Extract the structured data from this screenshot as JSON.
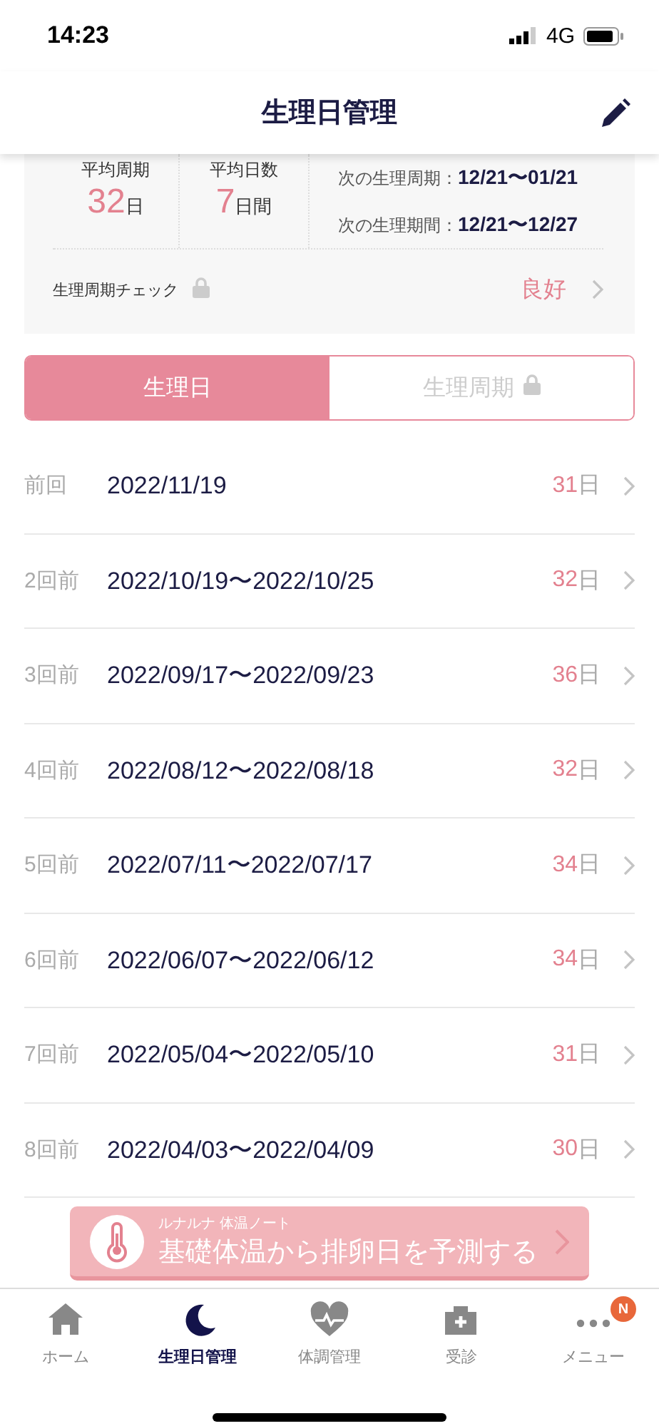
{
  "status_bar": {
    "time": "14:23",
    "network": "4G"
  },
  "header": {
    "title": "生理日管理"
  },
  "summary": {
    "stats": [
      {
        "label": "平均周期",
        "value": "32",
        "unit": "日"
      },
      {
        "label": "平均日数",
        "value": "7",
        "unit": "日間"
      }
    ],
    "forecasts": [
      {
        "label": "次の生理周期：",
        "value": "12/21〜01/21"
      },
      {
        "label": "次の生理期間：",
        "value": "12/21〜12/27"
      }
    ],
    "check": {
      "label": "生理周期チェック",
      "locked": true,
      "result": "良好"
    }
  },
  "segments": [
    {
      "label": "生理日",
      "selected": true,
      "locked": false
    },
    {
      "label": "生理周期",
      "selected": false,
      "locked": true
    }
  ],
  "history": [
    {
      "ago": "前回",
      "dates": "2022/11/19",
      "days": "31",
      "unit": "日"
    },
    {
      "ago": "2回前",
      "dates": "2022/10/19〜2022/10/25",
      "days": "32",
      "unit": "日"
    },
    {
      "ago": "3回前",
      "dates": "2022/09/17〜2022/09/23",
      "days": "36",
      "unit": "日"
    },
    {
      "ago": "4回前",
      "dates": "2022/08/12〜2022/08/18",
      "days": "32",
      "unit": "日"
    },
    {
      "ago": "5回前",
      "dates": "2022/07/11〜2022/07/17",
      "days": "34",
      "unit": "日"
    },
    {
      "ago": "6回前",
      "dates": "2022/06/07〜2022/06/12",
      "days": "34",
      "unit": "日"
    },
    {
      "ago": "7回前",
      "dates": "2022/05/04〜2022/05/10",
      "days": "31",
      "unit": "日"
    },
    {
      "ago": "8回前",
      "dates": "2022/04/03〜2022/04/09",
      "days": "30",
      "unit": "日"
    }
  ],
  "banner": {
    "caption": "ルナルナ 体温ノート",
    "text": "基礎体温から排卵日を予測する"
  },
  "tabs": [
    {
      "kind": "home",
      "label": "ホーム",
      "selected": false
    },
    {
      "kind": "moon",
      "label": "生理日管理",
      "selected": true
    },
    {
      "kind": "heart",
      "label": "体調管理",
      "selected": false
    },
    {
      "kind": "clinic",
      "label": "受診",
      "selected": false
    },
    {
      "kind": "more",
      "label": "メニュー",
      "selected": false,
      "badge": "N"
    }
  ]
}
